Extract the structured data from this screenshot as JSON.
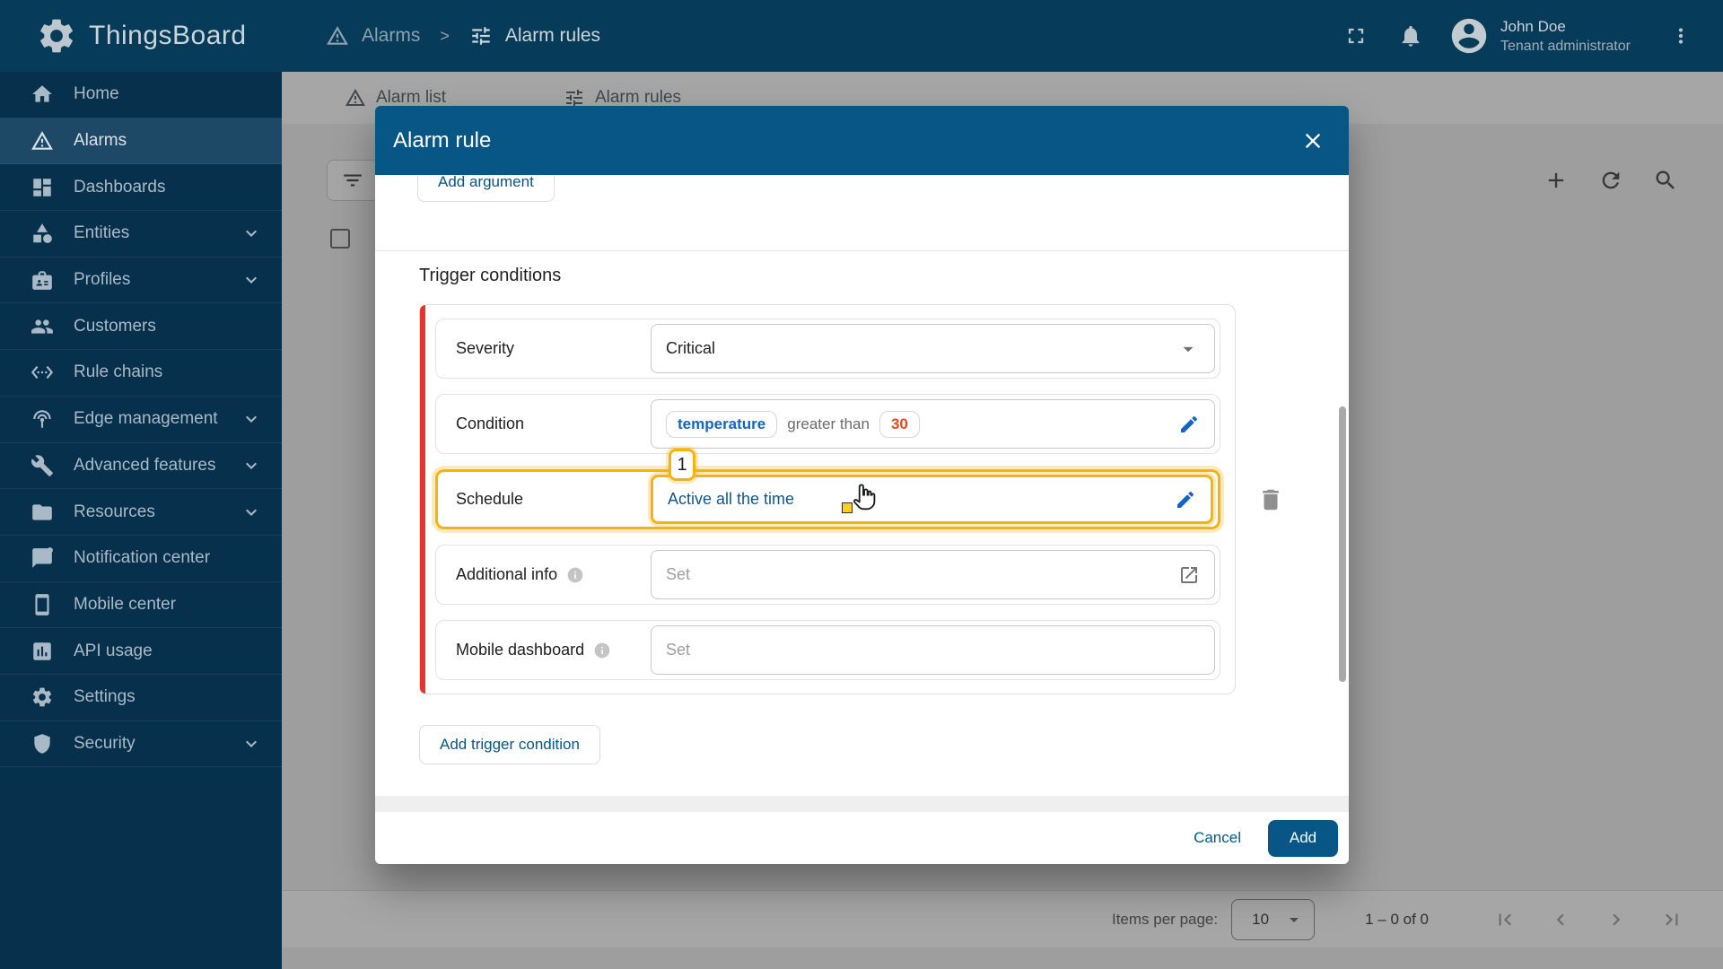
{
  "app": {
    "title": "ThingsBoard"
  },
  "topbar": {
    "breadcrumb": {
      "section": "Alarms",
      "separator": ">",
      "page": "Alarm rules"
    },
    "user": {
      "name": "John Doe",
      "role": "Tenant administrator"
    }
  },
  "sidebar": {
    "items": [
      {
        "label": "Home",
        "icon": "home-icon",
        "active": false,
        "expandable": false
      },
      {
        "label": "Alarms",
        "icon": "warning-icon",
        "active": true,
        "expandable": false
      },
      {
        "label": "Dashboards",
        "icon": "dashboards-icon",
        "active": false,
        "expandable": false
      },
      {
        "label": "Entities",
        "icon": "entities-icon",
        "active": false,
        "expandable": true
      },
      {
        "label": "Profiles",
        "icon": "profiles-icon",
        "active": false,
        "expandable": true
      },
      {
        "label": "Customers",
        "icon": "customers-icon",
        "active": false,
        "expandable": false
      },
      {
        "label": "Rule chains",
        "icon": "rule-chains-icon",
        "active": false,
        "expandable": false
      },
      {
        "label": "Edge management",
        "icon": "edge-icon",
        "active": false,
        "expandable": true
      },
      {
        "label": "Advanced features",
        "icon": "tools-icon",
        "active": false,
        "expandable": true
      },
      {
        "label": "Resources",
        "icon": "folder-icon",
        "active": false,
        "expandable": true
      },
      {
        "label": "Notification center",
        "icon": "notification-icon",
        "active": false,
        "expandable": false
      },
      {
        "label": "Mobile center",
        "icon": "mobile-icon",
        "active": false,
        "expandable": false
      },
      {
        "label": "API usage",
        "icon": "chart-icon",
        "active": false,
        "expandable": false
      },
      {
        "label": "Settings",
        "icon": "gear-icon",
        "active": false,
        "expandable": false
      },
      {
        "label": "Security",
        "icon": "shield-icon",
        "active": false,
        "expandable": true
      }
    ]
  },
  "content": {
    "tabs": [
      {
        "label": "Alarm list",
        "icon": "warning-icon"
      },
      {
        "label": "Alarm rules",
        "icon": "tune-icon"
      }
    ],
    "pagination": {
      "label": "Items per page:",
      "page_size": "10",
      "range": "1 – 0 of 0"
    }
  },
  "dialog": {
    "title": "Alarm rule",
    "add_argument_label": "Add argument",
    "section_title": "Trigger conditions",
    "severity": {
      "label": "Severity",
      "value": "Critical"
    },
    "condition": {
      "label": "Condition",
      "argument": "temperature",
      "operator": "greater than",
      "value": "30"
    },
    "schedule": {
      "label": "Schedule",
      "value": "Active all the time"
    },
    "additional_info": {
      "label": "Additional info",
      "placeholder": "Set"
    },
    "mobile_dashboard": {
      "label": "Mobile dashboard",
      "placeholder": "Set"
    },
    "add_trigger_condition_label": "Add trigger condition",
    "cancel_label": "Cancel",
    "add_label": "Add",
    "annotation_badge": "1"
  },
  "colors": {
    "primary": "#075685",
    "topbar": "#063b5a",
    "sidebar": "#07304d",
    "sidebar_active": "#1d4866",
    "accent_red": "#e6352e",
    "highlight_amber": "#f7b30d",
    "condition_key_blue": "#1565c0",
    "condition_value_orange": "#e4481c"
  }
}
